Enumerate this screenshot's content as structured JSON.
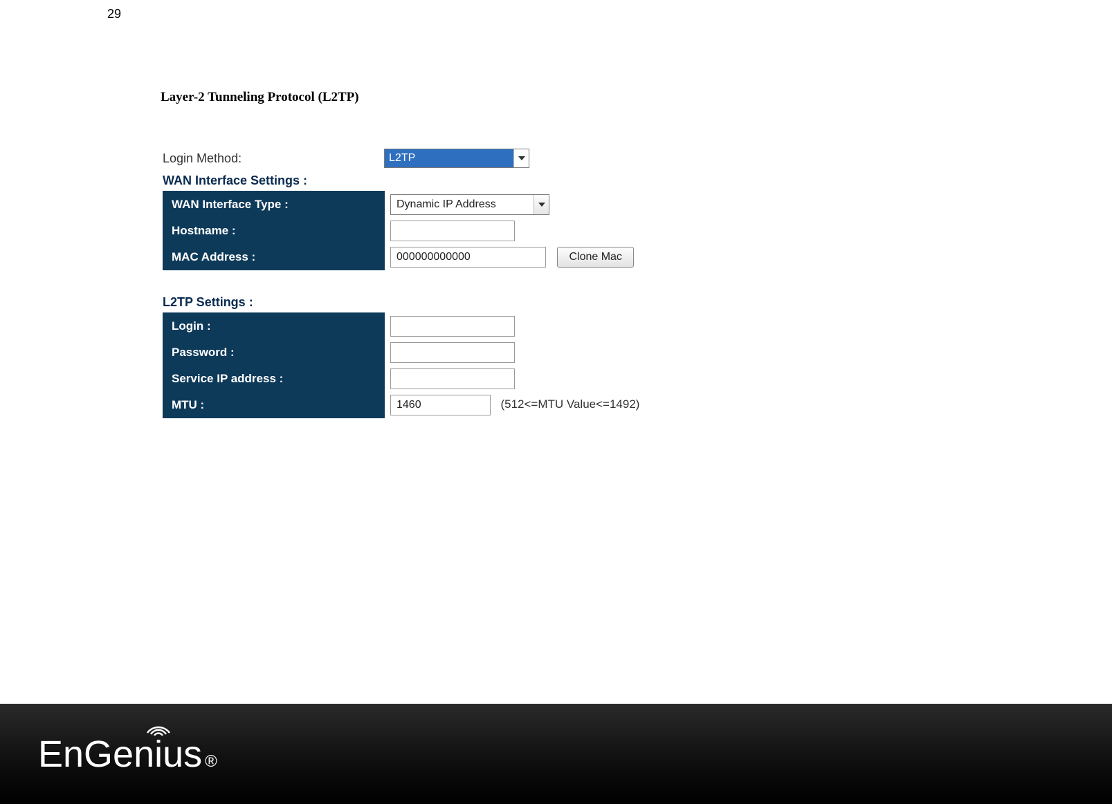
{
  "page_number": "29",
  "page_title": "Layer-2 Tunneling Protocol (L2TP)",
  "login_method": {
    "label": "Login Method:",
    "value": "L2TP"
  },
  "wan": {
    "section": "WAN Interface Settings :",
    "interface_type": {
      "label": "WAN Interface Type :",
      "value": "Dynamic IP Address"
    },
    "hostname": {
      "label": "Hostname :",
      "value": ""
    },
    "mac": {
      "label": "MAC Address :",
      "value": "000000000000",
      "button": "Clone Mac"
    }
  },
  "l2tp": {
    "section": "L2TP Settings :",
    "login": {
      "label": "Login :",
      "value": ""
    },
    "password": {
      "label": "Password :",
      "value": ""
    },
    "service_ip": {
      "label": "Service IP address :",
      "value": ""
    },
    "mtu": {
      "label": "MTU :",
      "value": "1460",
      "hint": "(512<=MTU Value<=1492)"
    }
  },
  "brand": {
    "name": "EnGenius",
    "reg": "®"
  }
}
